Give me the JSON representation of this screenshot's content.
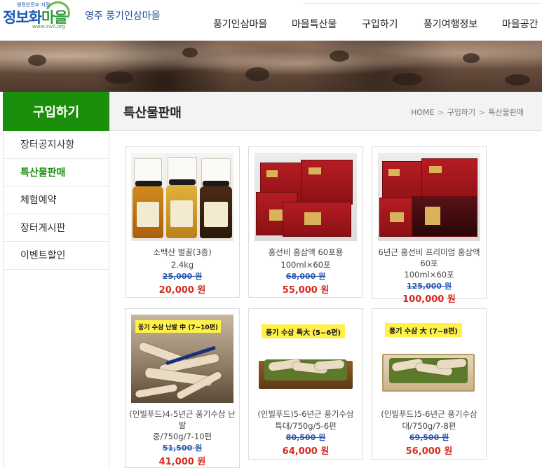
{
  "header": {
    "logo_top": "행정안전부 지정",
    "logo_main_a": "정보화",
    "logo_main_b": "마을",
    "logo_url": "www.invil.org",
    "village_name": "영주 풍기인삼마을"
  },
  "gnb": [
    "풍기인삼마을",
    "마을특산물",
    "구입하기",
    "풍기여행정보",
    "마을공간"
  ],
  "sidebar": {
    "title": "구입하기",
    "items": [
      {
        "label": "장터공지사항",
        "active": false
      },
      {
        "label": "특산물판매",
        "active": true
      },
      {
        "label": "체험예약",
        "active": false
      },
      {
        "label": "장터게시판",
        "active": false
      },
      {
        "label": "이벤트할인",
        "active": false
      }
    ]
  },
  "content": {
    "title": "특산물판매",
    "breadcrumb": [
      "HOME",
      "구입하기",
      "특산물판매"
    ],
    "breadcrumb_sep": ">"
  },
  "products": [
    {
      "name": "소백산 벌꿀(3종)",
      "spec": "2.4kg",
      "original_price": "25,000 원",
      "sale_price": "20,000 원",
      "image_icon": "honey-jars"
    },
    {
      "name": "홍선비 홍삼액 60포용",
      "spec": "100ml×60포",
      "original_price": "68,000 원",
      "sale_price": "55,000 원",
      "image_icon": "red-ginseng-boxes"
    },
    {
      "name": "6년근 홍선비 프리미엄 홍삼액 60포",
      "spec": "100ml×60포",
      "original_price": "125,000 원",
      "sale_price": "100,000 원",
      "image_icon": "premium-red-ginseng-boxes"
    },
    {
      "name": "(인빌푸드)4-5년근 풍기수삼 난발",
      "spec": "중/750g/7-10편",
      "original_price": "51,500 원",
      "sale_price": "41,000 원",
      "image_icon": "ginseng-roots",
      "image_tag": "풍기 수삼 난발 中 (7~10편)"
    },
    {
      "name": "(인빌푸드)5-6년근 풍기수삼",
      "spec": "특대/750g/5-6편",
      "original_price": "80,500 원",
      "sale_price": "64,000 원",
      "image_icon": "ginseng-tray",
      "image_tag": "풍기 수삼 특大 (5~6편)"
    },
    {
      "name": "(인빌푸드)5-6년근 풍기수삼",
      "spec": "대/750g/7-8편",
      "original_price": "69,500 원",
      "sale_price": "56,000 원",
      "image_icon": "ginseng-box",
      "image_tag": "풍기 수삼 大 (7~8편)"
    }
  ],
  "colors": {
    "accent_green": "#1b8e0b",
    "sale_red": "#d52b1e",
    "original_blue": "#2b56b0"
  }
}
